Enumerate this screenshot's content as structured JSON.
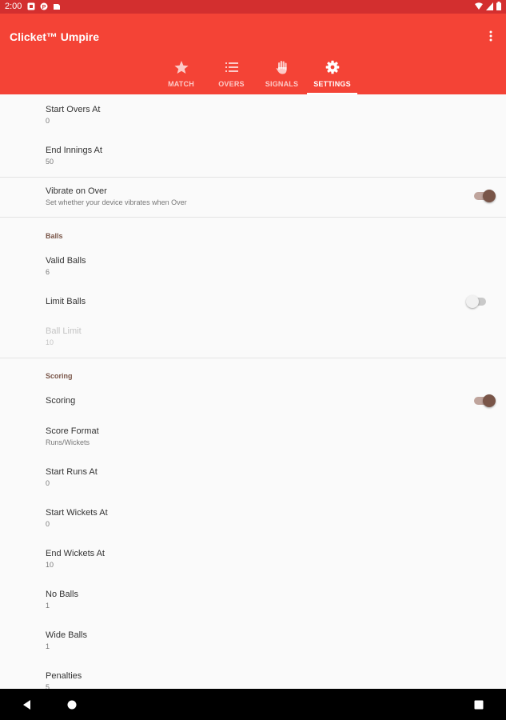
{
  "status_bar": {
    "time": "2:00",
    "notification_icons": [
      "notification-icon",
      "notification-icon",
      "notification-icon",
      "notification-icon"
    ],
    "right_icons": [
      "wifi-icon",
      "signal-icon",
      "battery-icon"
    ]
  },
  "app_bar": {
    "title": "Clicket™ Umpire",
    "menu_icon": "more-vert-icon",
    "tabs": [
      {
        "label": "MATCH",
        "icon": "star-icon",
        "active": false
      },
      {
        "label": "OVERS",
        "icon": "list-icon",
        "active": false
      },
      {
        "label": "SIGNALS",
        "icon": "hand-icon",
        "active": false
      },
      {
        "label": "SETTINGS",
        "icon": "gear-icon",
        "active": true
      }
    ]
  },
  "settings": {
    "start_overs": {
      "title": "Start Overs At",
      "summary": "0"
    },
    "end_innings": {
      "title": "End Innings At",
      "summary": "50"
    },
    "vibrate": {
      "title": "Vibrate on Over",
      "summary": "Set whether your device vibrates when Over",
      "enabled": true
    },
    "balls_category": "Balls",
    "valid_balls": {
      "title": "Valid Balls",
      "summary": "6"
    },
    "limit_balls": {
      "title": "Limit Balls",
      "enabled": false
    },
    "ball_limit": {
      "title": "Ball Limit",
      "summary": "10",
      "disabled": true
    },
    "scoring_category": "Scoring",
    "scoring": {
      "title": "Scoring",
      "enabled": true
    },
    "score_format": {
      "title": "Score Format",
      "summary": "Runs/Wickets"
    },
    "start_runs": {
      "title": "Start Runs At",
      "summary": "0"
    },
    "start_wickets": {
      "title": "Start Wickets At",
      "summary": "0"
    },
    "end_wickets": {
      "title": "End Wickets At",
      "summary": "10"
    },
    "no_balls": {
      "title": "No Balls",
      "summary": "1"
    },
    "wide_balls": {
      "title": "Wide Balls",
      "summary": "1"
    },
    "penalties": {
      "title": "Penalties",
      "summary": "5"
    }
  },
  "nav_bar": {
    "back_icon": "back-icon",
    "home_icon": "home-icon",
    "recents_icon": "recents-icon"
  },
  "colors": {
    "status_bar": "#d32f2f",
    "app_bar": "#f44336",
    "accent": "#795548",
    "background": "#fafafa"
  }
}
